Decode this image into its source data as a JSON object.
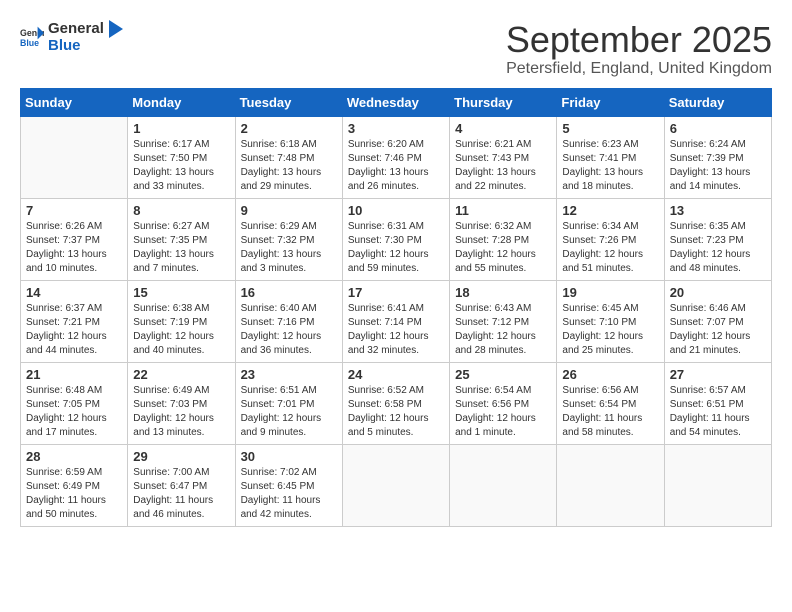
{
  "header": {
    "logo_general": "General",
    "logo_blue": "Blue",
    "month_year": "September 2025",
    "location": "Petersfield, England, United Kingdom"
  },
  "weekdays": [
    "Sunday",
    "Monday",
    "Tuesday",
    "Wednesday",
    "Thursday",
    "Friday",
    "Saturday"
  ],
  "weeks": [
    [
      {
        "day": "",
        "info": ""
      },
      {
        "day": "1",
        "info": "Sunrise: 6:17 AM\nSunset: 7:50 PM\nDaylight: 13 hours\nand 33 minutes."
      },
      {
        "day": "2",
        "info": "Sunrise: 6:18 AM\nSunset: 7:48 PM\nDaylight: 13 hours\nand 29 minutes."
      },
      {
        "day": "3",
        "info": "Sunrise: 6:20 AM\nSunset: 7:46 PM\nDaylight: 13 hours\nand 26 minutes."
      },
      {
        "day": "4",
        "info": "Sunrise: 6:21 AM\nSunset: 7:43 PM\nDaylight: 13 hours\nand 22 minutes."
      },
      {
        "day": "5",
        "info": "Sunrise: 6:23 AM\nSunset: 7:41 PM\nDaylight: 13 hours\nand 18 minutes."
      },
      {
        "day": "6",
        "info": "Sunrise: 6:24 AM\nSunset: 7:39 PM\nDaylight: 13 hours\nand 14 minutes."
      }
    ],
    [
      {
        "day": "7",
        "info": "Sunrise: 6:26 AM\nSunset: 7:37 PM\nDaylight: 13 hours\nand 10 minutes."
      },
      {
        "day": "8",
        "info": "Sunrise: 6:27 AM\nSunset: 7:35 PM\nDaylight: 13 hours\nand 7 minutes."
      },
      {
        "day": "9",
        "info": "Sunrise: 6:29 AM\nSunset: 7:32 PM\nDaylight: 13 hours\nand 3 minutes."
      },
      {
        "day": "10",
        "info": "Sunrise: 6:31 AM\nSunset: 7:30 PM\nDaylight: 12 hours\nand 59 minutes."
      },
      {
        "day": "11",
        "info": "Sunrise: 6:32 AM\nSunset: 7:28 PM\nDaylight: 12 hours\nand 55 minutes."
      },
      {
        "day": "12",
        "info": "Sunrise: 6:34 AM\nSunset: 7:26 PM\nDaylight: 12 hours\nand 51 minutes."
      },
      {
        "day": "13",
        "info": "Sunrise: 6:35 AM\nSunset: 7:23 PM\nDaylight: 12 hours\nand 48 minutes."
      }
    ],
    [
      {
        "day": "14",
        "info": "Sunrise: 6:37 AM\nSunset: 7:21 PM\nDaylight: 12 hours\nand 44 minutes."
      },
      {
        "day": "15",
        "info": "Sunrise: 6:38 AM\nSunset: 7:19 PM\nDaylight: 12 hours\nand 40 minutes."
      },
      {
        "day": "16",
        "info": "Sunrise: 6:40 AM\nSunset: 7:16 PM\nDaylight: 12 hours\nand 36 minutes."
      },
      {
        "day": "17",
        "info": "Sunrise: 6:41 AM\nSunset: 7:14 PM\nDaylight: 12 hours\nand 32 minutes."
      },
      {
        "day": "18",
        "info": "Sunrise: 6:43 AM\nSunset: 7:12 PM\nDaylight: 12 hours\nand 28 minutes."
      },
      {
        "day": "19",
        "info": "Sunrise: 6:45 AM\nSunset: 7:10 PM\nDaylight: 12 hours\nand 25 minutes."
      },
      {
        "day": "20",
        "info": "Sunrise: 6:46 AM\nSunset: 7:07 PM\nDaylight: 12 hours\nand 21 minutes."
      }
    ],
    [
      {
        "day": "21",
        "info": "Sunrise: 6:48 AM\nSunset: 7:05 PM\nDaylight: 12 hours\nand 17 minutes."
      },
      {
        "day": "22",
        "info": "Sunrise: 6:49 AM\nSunset: 7:03 PM\nDaylight: 12 hours\nand 13 minutes."
      },
      {
        "day": "23",
        "info": "Sunrise: 6:51 AM\nSunset: 7:01 PM\nDaylight: 12 hours\nand 9 minutes."
      },
      {
        "day": "24",
        "info": "Sunrise: 6:52 AM\nSunset: 6:58 PM\nDaylight: 12 hours\nand 5 minutes."
      },
      {
        "day": "25",
        "info": "Sunrise: 6:54 AM\nSunset: 6:56 PM\nDaylight: 12 hours\nand 1 minute."
      },
      {
        "day": "26",
        "info": "Sunrise: 6:56 AM\nSunset: 6:54 PM\nDaylight: 11 hours\nand 58 minutes."
      },
      {
        "day": "27",
        "info": "Sunrise: 6:57 AM\nSunset: 6:51 PM\nDaylight: 11 hours\nand 54 minutes."
      }
    ],
    [
      {
        "day": "28",
        "info": "Sunrise: 6:59 AM\nSunset: 6:49 PM\nDaylight: 11 hours\nand 50 minutes."
      },
      {
        "day": "29",
        "info": "Sunrise: 7:00 AM\nSunset: 6:47 PM\nDaylight: 11 hours\nand 46 minutes."
      },
      {
        "day": "30",
        "info": "Sunrise: 7:02 AM\nSunset: 6:45 PM\nDaylight: 11 hours\nand 42 minutes."
      },
      {
        "day": "",
        "info": ""
      },
      {
        "day": "",
        "info": ""
      },
      {
        "day": "",
        "info": ""
      },
      {
        "day": "",
        "info": ""
      }
    ]
  ]
}
